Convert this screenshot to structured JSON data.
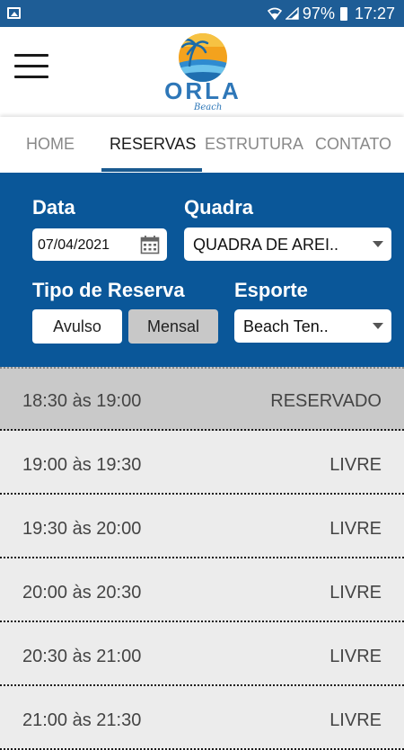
{
  "status_bar": {
    "battery": "97%",
    "time": "17:27",
    "icons": [
      "gallery-icon",
      "wifi-icon",
      "signal-icon",
      "battery-icon"
    ]
  },
  "app": {
    "logo_text": "ORLA",
    "logo_subtitle": "Beach",
    "menu_icon": "menu-icon"
  },
  "tabs": [
    {
      "label": "HOME",
      "active": false
    },
    {
      "label": "RESERVAS",
      "active": true
    },
    {
      "label": "ESTRUTURA",
      "active": false
    },
    {
      "label": "CONTATO",
      "active": false
    }
  ],
  "form": {
    "date_label": "Data",
    "date_value": "07/04/2021",
    "quadra_label": "Quadra",
    "quadra_value": "QUADRA DE AREI..",
    "tipo_label": "Tipo de Reserva",
    "tipo_options": [
      "Avulso",
      "Mensal"
    ],
    "tipo_selected": "Mensal",
    "esporte_label": "Esporte",
    "esporte_value": "Beach Ten.."
  },
  "slots": [
    {
      "time": "18:30 às 19:00",
      "status": "RESERVADO",
      "reserved": true
    },
    {
      "time": "19:00 às 19:30",
      "status": "LIVRE",
      "reserved": false
    },
    {
      "time": "19:30 às 20:00",
      "status": "LIVRE",
      "reserved": false
    },
    {
      "time": "20:00 às 20:30",
      "status": "LIVRE",
      "reserved": false
    },
    {
      "time": "20:30 às 21:00",
      "status": "LIVRE",
      "reserved": false
    },
    {
      "time": "21:00 às 21:30",
      "status": "LIVRE",
      "reserved": false
    }
  ],
  "colors": {
    "primary": "#0a5799",
    "status_bar": "#1e5d96",
    "list_bg": "#ececec",
    "reserved_bg": "#c9c9c9"
  }
}
